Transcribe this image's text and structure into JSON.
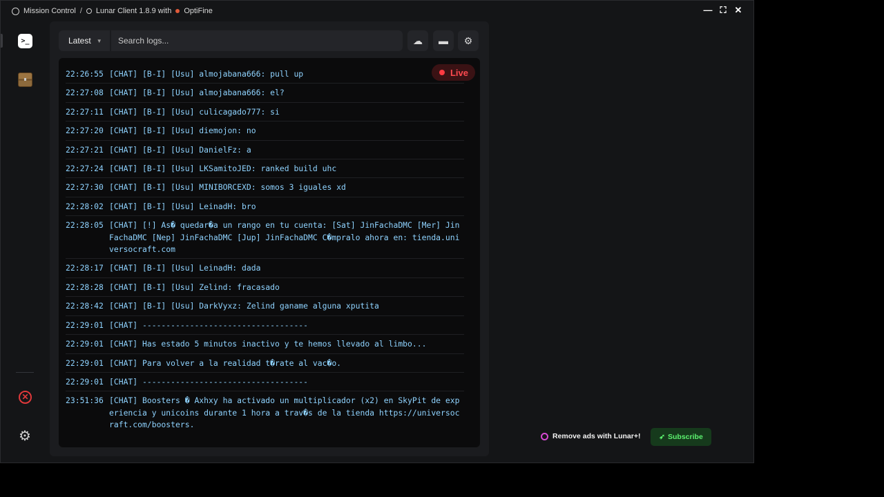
{
  "titlebar": {
    "crumb_root": "Mission Control",
    "separator": "/",
    "crumb_client": "Lunar Client 1.8.9 with",
    "crumb_optifine": "OptiFine",
    "controls": {
      "minimize": "—",
      "maximize": "⛶",
      "close": "✕"
    }
  },
  "sidebar": {
    "terminal_icon": "terminal-icon",
    "chest_icon": "chest-icon",
    "error_icon": "close-circle-icon",
    "settings_icon": "gear-icon"
  },
  "toolbar": {
    "log_select": "Latest",
    "search_placeholder": "Search logs...",
    "buttons": [
      "upload-cloud-icon",
      "folder-icon",
      "gear-icon"
    ]
  },
  "log": {
    "live_label": "Live",
    "entries": [
      {
        "time": "22:26:55",
        "text": "[CHAT] [B-I] [Usu] almojabana666: pull up"
      },
      {
        "time": "22:27:08",
        "text": "[CHAT] [B-I] [Usu] almojabana666: el?"
      },
      {
        "time": "22:27:11",
        "text": "[CHAT] [B-I] [Usu] culicagado777: si"
      },
      {
        "time": "22:27:20",
        "text": "[CHAT] [B-I] [Usu] diemojon: no"
      },
      {
        "time": "22:27:21",
        "text": "[CHAT] [B-I] [Usu] DanielFz: a"
      },
      {
        "time": "22:27:24",
        "text": "[CHAT] [B-I] [Usu] LKSamitoJED: ranked build uhc"
      },
      {
        "time": "22:27:30",
        "text": "[CHAT] [B-I] [Usu] MINIBORCEXD: somos 3 iguales xd"
      },
      {
        "time": "22:28:02",
        "text": "[CHAT] [B-I] [Usu] LeinadH: bro"
      },
      {
        "time": "22:28:05",
        "text": "[CHAT] [!] As� quedar�a un rango en tu cuenta: [Sat] JinFachaDMC [Mer] JinFachaDMC [Nep] JinFachaDMC [Jup] JinFachaDMC C�mpralo ahora en: tienda.universocraft.com"
      },
      {
        "time": "22:28:17",
        "text": "[CHAT] [B-I] [Usu] LeinadH: dada"
      },
      {
        "time": "22:28:28",
        "text": "[CHAT] [B-I] [Usu] Zelind: fracasado"
      },
      {
        "time": "22:28:42",
        "text": "[CHAT] [B-I] [Usu] DarkVyxz: Zelind ganame alguna xputita"
      },
      {
        "time": "22:29:01",
        "text": "[CHAT] -----------------------------------"
      },
      {
        "time": "22:29:01",
        "text": "[CHAT] Has estado 5 minutos inactivo y te hemos llevado al limbo..."
      },
      {
        "time": "22:29:01",
        "text": "[CHAT] Para volver a la realidad t�rate al vac�o."
      },
      {
        "time": "22:29:01",
        "text": "[CHAT] -----------------------------------"
      },
      {
        "time": "23:51:36",
        "text": "[CHAT] Boosters � Axhxy ha activado un multiplicador (x2) en SkyPit de experiencia y unicoins durante 1 hora a trav�s de la tienda https://universocraft.com/boosters."
      }
    ]
  },
  "promo": {
    "text": "Remove ads with Lunar+!",
    "subscribe": "Subscribe"
  },
  "colors": {
    "log_text": "#8fd3ff",
    "live": "#ff4a4f",
    "subscribe_text": "#5cf26f"
  }
}
